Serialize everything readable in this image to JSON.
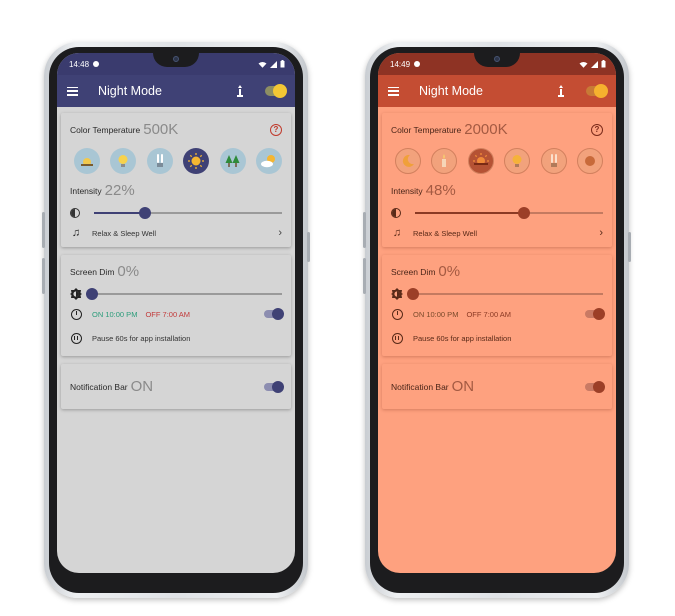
{
  "phones": [
    {
      "id": "left",
      "status": {
        "time": "14:48"
      },
      "appbar": {
        "title": "Night Mode"
      },
      "color_temperature": {
        "label": "Color Temperature",
        "value": "500K",
        "presets": [
          "sunrise-icon",
          "bulb-icon",
          "fluorescent-icon",
          "sun-icon",
          "forest-icon",
          "cloudy-sun-icon"
        ],
        "active_index": 3
      },
      "intensity": {
        "label": "Intensity",
        "value": "22%",
        "level": 0.27
      },
      "relax": {
        "label": "Relax & Sleep Well"
      },
      "screen_dim": {
        "label": "Screen Dim",
        "value": "0%",
        "level": 0.0
      },
      "schedule": {
        "on": "ON 10:00 PM",
        "off": "OFF 7:00 AM"
      },
      "pause": {
        "label": "Pause 60s for app installation"
      },
      "notification_bar": {
        "label": "Notification Bar",
        "value": "ON"
      }
    },
    {
      "id": "right",
      "status": {
        "time": "14:49"
      },
      "appbar": {
        "title": "Night Mode"
      },
      "color_temperature": {
        "label": "Color Temperature",
        "value": "2000K",
        "presets": [
          "moon-icon",
          "candle-icon",
          "sunset-icon",
          "bulb-icon",
          "fluorescent-icon",
          "circle-icon"
        ],
        "active_index": 2
      },
      "intensity": {
        "label": "Intensity",
        "value": "48%",
        "level": 0.58
      },
      "relax": {
        "label": "Relax & Sleep Well"
      },
      "screen_dim": {
        "label": "Screen Dim",
        "value": "0%",
        "level": 0.0
      },
      "schedule": {
        "on": "ON 10:00 PM",
        "off": "OFF 7:00 AM"
      },
      "pause": {
        "label": "Pause 60s for app installation"
      },
      "notification_bar": {
        "label": "Notification Bar",
        "value": "ON"
      }
    }
  ]
}
